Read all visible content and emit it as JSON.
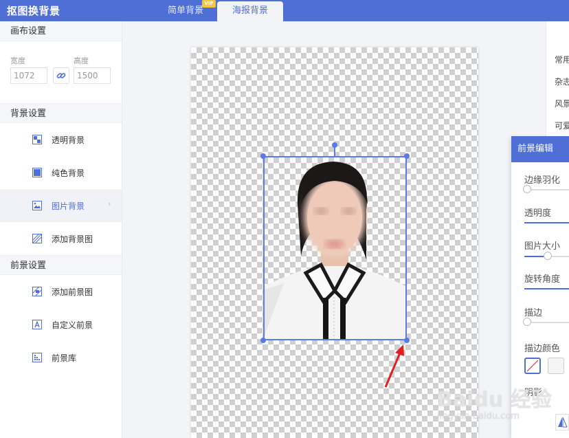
{
  "header": {
    "app_title": "抠图换背景",
    "tabs": [
      {
        "label": "简单背景",
        "badge": "VIP"
      },
      {
        "label": "海报背景"
      }
    ]
  },
  "canvas_settings": {
    "heading": "画布设置",
    "width_label": "宽度",
    "width_value": "1072",
    "height_label": "高度",
    "height_value": "1500"
  },
  "background_settings": {
    "heading": "背景设置",
    "items": [
      {
        "label": "透明背景",
        "icon": "transparent-bg-icon"
      },
      {
        "label": "纯色背景",
        "icon": "solid-color-icon"
      },
      {
        "label": "图片背景",
        "icon": "image-icon",
        "active": true
      },
      {
        "label": "添加背景图",
        "icon": "add-bg-image-icon"
      }
    ]
  },
  "foreground_settings": {
    "heading": "前景设置",
    "items": [
      {
        "label": "添加前景图",
        "icon": "add-fg-image-icon"
      },
      {
        "label": "自定义前景",
        "icon": "text-a-icon"
      },
      {
        "label": "前景库",
        "icon": "library-icon"
      }
    ]
  },
  "right_categories": [
    "常用",
    "杂志",
    "风景",
    "可爱"
  ],
  "foreground_edit": {
    "title": "前景编辑",
    "props": [
      {
        "label": "边缘羽化",
        "value": 0
      },
      {
        "label": "透明度",
        "value": 1.0
      },
      {
        "label": "图片大小",
        "value": 0.5
      },
      {
        "label": "旋转角度",
        "value": 1.0
      },
      {
        "label": "描边",
        "value": 0
      }
    ],
    "stroke_color_label": "描边颜色",
    "shadow_label": "阴影"
  },
  "watermark": {
    "logo": "Baidu 经验",
    "url": "jingyan.baidu.com"
  },
  "colors": {
    "accent": "#4f6ed6",
    "selection": "#5b79e8",
    "arrow": "#e02020"
  }
}
